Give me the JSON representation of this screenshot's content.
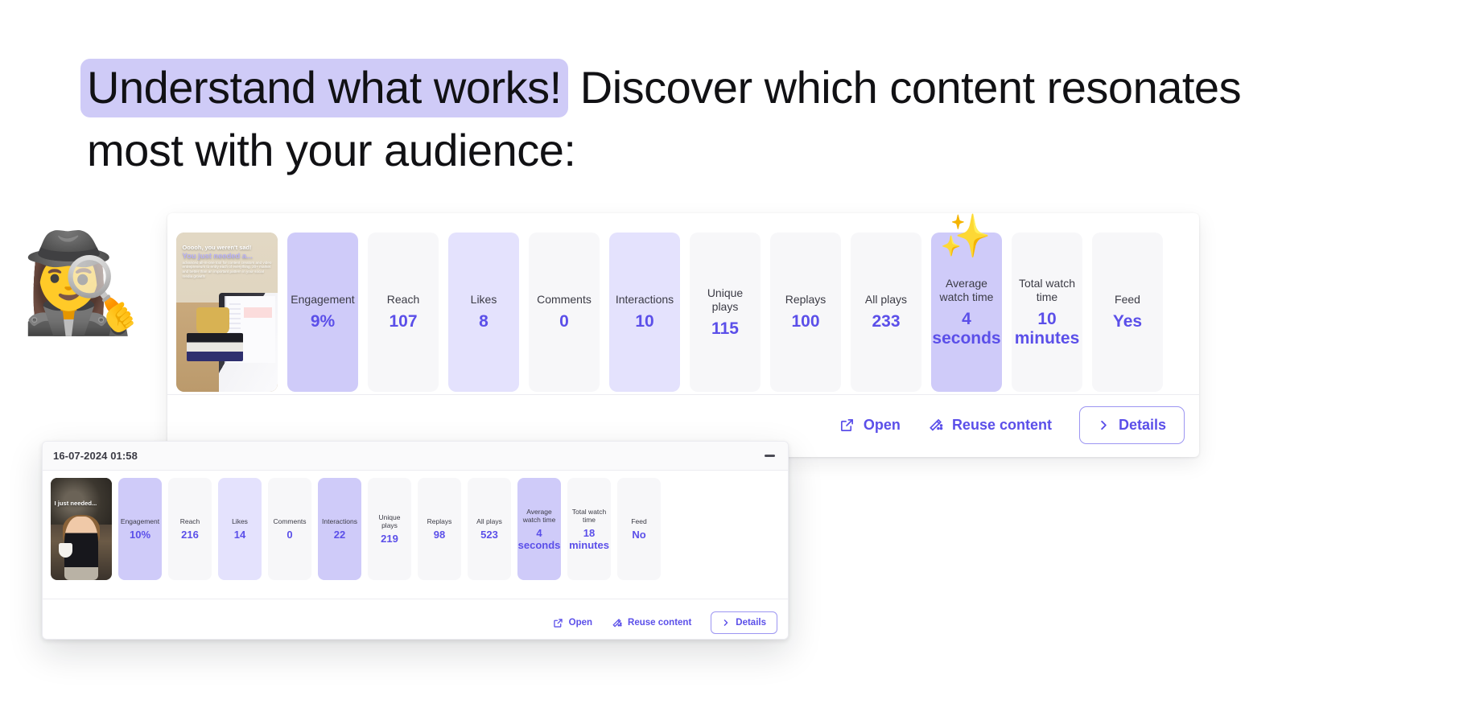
{
  "headline": {
    "highlighted": "Understand what works!",
    "rest": " Discover which content resonates most with your audience:",
    "highlight_color": "#cfcbf7"
  },
  "decor": {
    "detective_emoji": "🕵️‍♀️",
    "sparkles_emoji": "✨"
  },
  "theme": {
    "accent": "#5b4fe9",
    "tile_bg": "#f7f7f9",
    "tile_highlight_soft": "#e4e2fd",
    "tile_highlight_strong": "#cfcbf9",
    "border": "#ececf1"
  },
  "actions": {
    "open_label": "Open",
    "reuse_label": "Reuse content",
    "details_label": "Details"
  },
  "cards": [
    {
      "id": "top-post",
      "thumbnail": {
        "caption_line1": "Ooooh, you weren't sad!",
        "caption_line2": "You just needed a...",
        "caption_line3": "advanced all-in-one tool for content creators and video entrepreneurs to entry each of everything. 20+ market and better than an important pattern in your social media growth!"
      },
      "metrics": [
        {
          "label": "Engagement",
          "value": "9%",
          "highlight": "strong"
        },
        {
          "label": "Reach",
          "value": "107",
          "highlight": "none"
        },
        {
          "label": "Likes",
          "value": "8",
          "highlight": "soft"
        },
        {
          "label": "Comments",
          "value": "0",
          "highlight": "none"
        },
        {
          "label": "Interactions",
          "value": "10",
          "highlight": "soft"
        },
        {
          "label": "Unique plays",
          "value": "115",
          "highlight": "none"
        },
        {
          "label": "Replays",
          "value": "100",
          "highlight": "none"
        },
        {
          "label": "All plays",
          "value": "233",
          "highlight": "none"
        },
        {
          "label": "Average watch time",
          "value": "4 seconds",
          "highlight": "strong"
        },
        {
          "label": "Total watch time",
          "value": "10 minutes",
          "highlight": "none"
        },
        {
          "label": "Feed",
          "value": "Yes",
          "highlight": "none"
        }
      ]
    },
    {
      "id": "bottom-post",
      "timestamp": "16-07-2024 01:58",
      "thumbnail": {
        "caption_line1": "I just needed..."
      },
      "metrics": [
        {
          "label": "Engagement",
          "value": "10%",
          "highlight": "strong"
        },
        {
          "label": "Reach",
          "value": "216",
          "highlight": "none"
        },
        {
          "label": "Likes",
          "value": "14",
          "highlight": "soft"
        },
        {
          "label": "Comments",
          "value": "0",
          "highlight": "none"
        },
        {
          "label": "Interactions",
          "value": "22",
          "highlight": "strong"
        },
        {
          "label": "Unique plays",
          "value": "219",
          "highlight": "none"
        },
        {
          "label": "Replays",
          "value": "98",
          "highlight": "none"
        },
        {
          "label": "All plays",
          "value": "523",
          "highlight": "none"
        },
        {
          "label": "Average watch time",
          "value": "4 seconds",
          "highlight": "strong"
        },
        {
          "label": "Total watch time",
          "value": "18 minutes",
          "highlight": "none"
        },
        {
          "label": "Feed",
          "value": "No",
          "highlight": "none"
        }
      ]
    }
  ]
}
